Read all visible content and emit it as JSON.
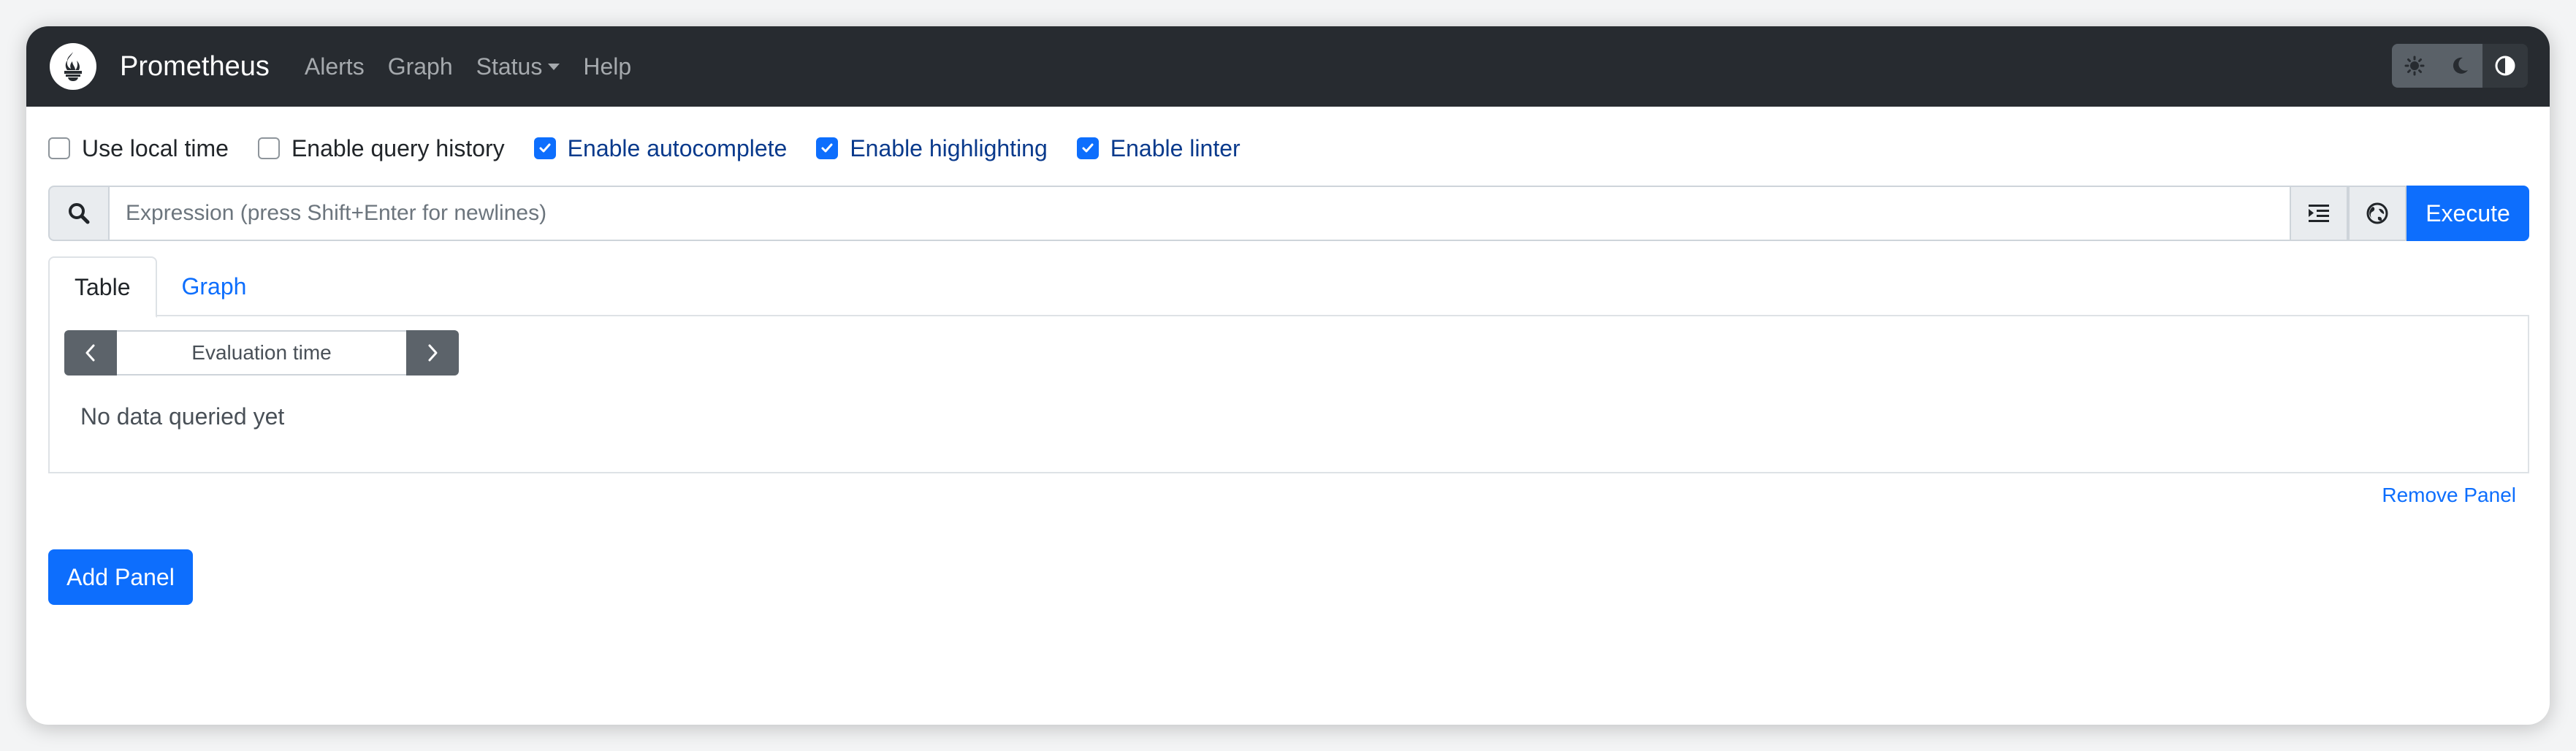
{
  "navbar": {
    "brand": "Prometheus",
    "links": {
      "alerts": "Alerts",
      "graph": "Graph",
      "status": "Status",
      "help": "Help"
    },
    "theme_buttons": [
      "sun-icon",
      "moon-icon",
      "contrast-icon"
    ]
  },
  "options": {
    "use_local_time": {
      "label": "Use local time",
      "checked": false
    },
    "enable_query_history": {
      "label": "Enable query history",
      "checked": false
    },
    "enable_autocomplete": {
      "label": "Enable autocomplete",
      "checked": true
    },
    "enable_highlighting": {
      "label": "Enable highlighting",
      "checked": true
    },
    "enable_linter": {
      "label": "Enable linter",
      "checked": true
    }
  },
  "expression": {
    "placeholder": "Expression (press Shift+Enter for newlines)",
    "value": "",
    "execute_label": "Execute"
  },
  "tabs": {
    "table": "Table",
    "graph": "Graph",
    "active": "table"
  },
  "table_panel": {
    "evaluation_time_placeholder": "Evaluation time",
    "empty_message": "No data queried yet"
  },
  "remove_panel_label": "Remove Panel",
  "add_panel_label": "Add Panel",
  "colors": {
    "navbar_bg": "#272b30",
    "primary": "#0d6efd",
    "secondary": "#5c636a"
  }
}
